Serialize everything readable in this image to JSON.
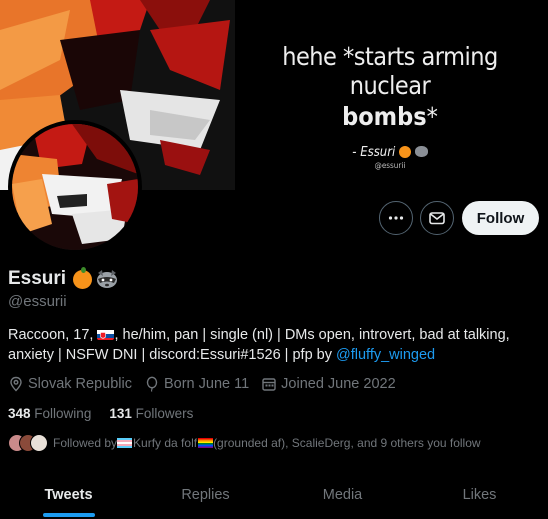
{
  "banner": {
    "quote_line1": "hehe *starts arming nuclear",
    "quote_line2_bold": "bombs",
    "quote_line2_rest": "*",
    "attribution": "- Essuri",
    "attribution_handle": "@essurii"
  },
  "actions": {
    "follow_label": "Follow"
  },
  "profile": {
    "display_name": "Essuri",
    "handle": "@essurii",
    "bio_part1": "Raccoon, 17, ",
    "bio_part2": ", he/him, pan | single (nl) | DMs open, introvert, bad at talking, anxiety | NSFW DNI | discord:Essuri#1526 | pfp by ",
    "bio_link": "@fluffy_winged",
    "location": "Slovak Republic",
    "birthday": "Born June 11",
    "joined": "Joined June 2022"
  },
  "stats": {
    "following_count": "348",
    "following_label": "Following",
    "followers_count": "131",
    "followers_label": "Followers"
  },
  "followed_by": {
    "prefix": "Followed by ",
    "name1": "Kurfy da folf",
    "rest": " (grounded af), ScalieDerg, and 9 others you follow"
  },
  "tabs": [
    "Tweets",
    "Replies",
    "Media",
    "Likes"
  ],
  "colors": {
    "accent": "#1d9bf0",
    "background": "#000000",
    "muted": "#71767b"
  }
}
